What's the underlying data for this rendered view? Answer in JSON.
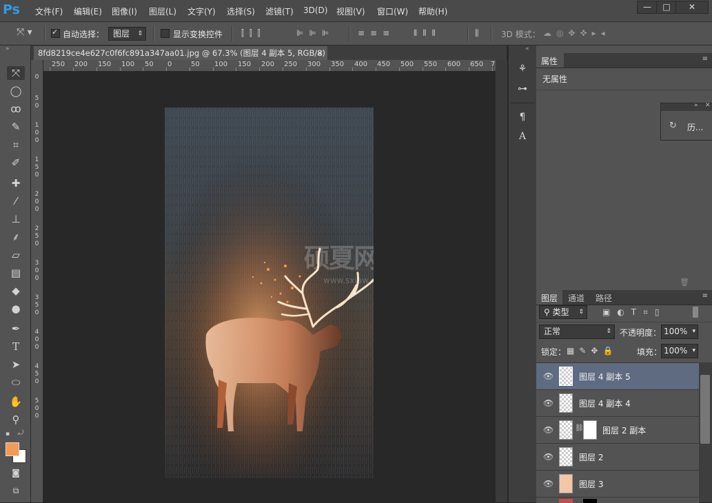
{
  "app": {
    "logo": "Ps"
  },
  "menu": [
    "文件(F)",
    "编辑(E)",
    "图像(I)",
    "图层(L)",
    "文字(Y)",
    "选择(S)",
    "滤镜(T)",
    "3D(D)",
    "视图(V)",
    "窗口(W)",
    "帮助(H)"
  ],
  "window_controls": {
    "minimize": "—",
    "maximize": "□",
    "close": "✕"
  },
  "options_bar": {
    "auto_select_label": "自动选择：",
    "auto_select_checked": true,
    "auto_select_target": "图层",
    "show_transform_label": "显示变换控件",
    "mode_3d_label": "3D 模式："
  },
  "document": {
    "tab_title": "8fd8219ce4e627c0f6fc891a347aa01.jpg @ 67.3% (图层 4 副本 5, RGB/8) *",
    "close": "×"
  },
  "ruler": {
    "top_labels": [
      "250",
      "200",
      "150",
      "100",
      "50",
      "0",
      "50",
      "100",
      "150",
      "200",
      "250",
      "300",
      "350",
      "400",
      "450",
      "500",
      "550",
      "600",
      "650",
      "7"
    ],
    "left_labels": [
      "0",
      "5",
      "0",
      "1",
      "0",
      "0",
      "1",
      "5",
      "0",
      "2",
      "0",
      "0",
      "2",
      "5",
      "0",
      "3",
      "0",
      "0",
      "3",
      "5",
      "0",
      "4",
      "0",
      "0",
      "4",
      "5",
      "0",
      "5",
      "0",
      "0"
    ]
  },
  "watermark": {
    "title": "硕夏网",
    "url": "www.sxiaw.com"
  },
  "properties_panel": {
    "tab": "属性",
    "content": "无属性"
  },
  "history_panel": {
    "label": "历..."
  },
  "layers_panel": {
    "tabs": [
      "图层",
      "通道",
      "路径"
    ],
    "filter_kind": "类型",
    "blend_mode": "正常",
    "opacity_label": "不透明度：",
    "opacity_value": "100%",
    "lock_label": "锁定：",
    "fill_label": "填充：",
    "fill_value": "100%",
    "layers": [
      {
        "name": "图层 4 副本 5",
        "selected": true
      },
      {
        "name": "图层 4 副本 4",
        "selected": false
      },
      {
        "name": "图层 2 副本",
        "selected": false
      },
      {
        "name": "图层 2",
        "selected": false
      },
      {
        "name": "图层 3",
        "selected": false
      }
    ]
  },
  "colors": {
    "foreground": "#f39a57",
    "background": "#ffffff",
    "accent": "#2f9ce8"
  }
}
